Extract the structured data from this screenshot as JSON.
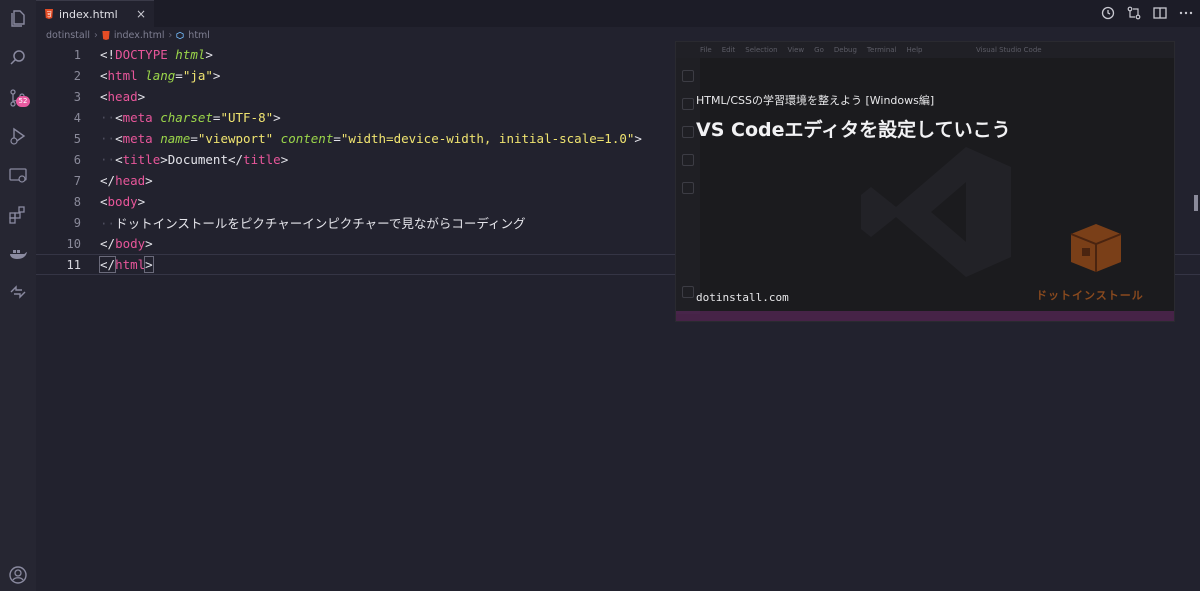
{
  "activity_bar": {
    "items": [
      {
        "name": "explorer-icon"
      },
      {
        "name": "search-icon"
      },
      {
        "name": "source-control-icon",
        "badge": "52"
      },
      {
        "name": "run-debug-icon"
      },
      {
        "name": "remote-explorer-icon"
      },
      {
        "name": "extensions-icon"
      },
      {
        "name": "docker-icon"
      },
      {
        "name": "live-share-icon"
      },
      {
        "name": "account-icon"
      }
    ]
  },
  "tab": {
    "label": "index.html",
    "close": "×"
  },
  "breadcrumb": {
    "folder": "dotinstall",
    "file": "index.html",
    "symbol": "html",
    "sep": "›"
  },
  "code_lines": [
    {
      "n": "1"
    },
    {
      "n": "2"
    },
    {
      "n": "3"
    },
    {
      "n": "4"
    },
    {
      "n": "5"
    },
    {
      "n": "6"
    },
    {
      "n": "7"
    },
    {
      "n": "8"
    },
    {
      "n": "9"
    },
    {
      "n": "10"
    },
    {
      "n": "11"
    }
  ],
  "code": {
    "l1_a": "<!",
    "l1_b": "DOCTYPE",
    "l1_c": " html",
    "l1_d": ">",
    "l2_a": "<",
    "l2_b": "html",
    "l2_c": " lang",
    "l2_d": "=",
    "l2_e": "\"ja\"",
    "l2_f": ">",
    "l3_a": "<",
    "l3_b": "head",
    "l3_c": ">",
    "l4_ws": "··",
    "l4_a": "<",
    "l4_b": "meta",
    "l4_c": " charset",
    "l4_d": "=",
    "l4_e": "\"UTF-8\"",
    "l4_f": ">",
    "l5_ws": "··",
    "l5_a": "<",
    "l5_b": "meta",
    "l5_c": " name",
    "l5_d": "=",
    "l5_e": "\"viewport\"",
    "l5_g": " content",
    "l5_h": "=",
    "l5_i": "\"width=device-width, initial-scale=1.0\"",
    "l5_f": ">",
    "l6_ws": "··",
    "l6_a": "<",
    "l6_b": "title",
    "l6_c": ">",
    "l6_d": "Document",
    "l6_e": "</",
    "l6_f": "title",
    "l6_g": ">",
    "l7_a": "</",
    "l7_b": "head",
    "l7_c": ">",
    "l8_a": "<",
    "l8_b": "body",
    "l8_c": ">",
    "l9_ws": "··",
    "l9_text": "ドットインストールをピクチャーインピクチャーで見ながらコーディング",
    "l10_a": "</",
    "l10_b": "body",
    "l10_c": ">",
    "l11_a": "</",
    "l11_b": "html",
    "l11_c": ">"
  },
  "pip": {
    "menu": [
      "File",
      "Edit",
      "Selection",
      "View",
      "Go",
      "Debug",
      "Terminal",
      "Help"
    ],
    "window_title": "Visual Studio Code",
    "subtitle": "HTML/CSSの学習環境を整えよう [Windows編]",
    "title": "VS Codeエディタを設定していこう",
    "url": "dotinstall.com",
    "logo_text": "ドットインストール"
  },
  "colors": {
    "tag": "#e8569a",
    "attr": "#9bd64a",
    "string": "#f0e470",
    "badge": "#e85aa0",
    "logo": "#8a4a1e"
  }
}
